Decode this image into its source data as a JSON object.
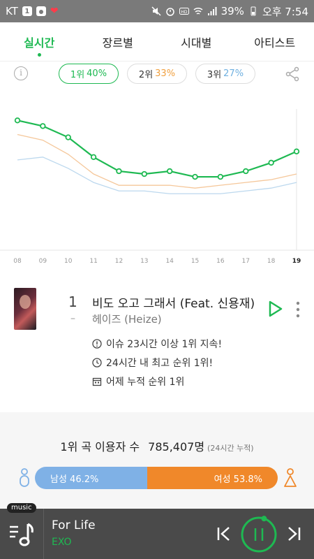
{
  "status_bar": {
    "carrier": "KT",
    "badge": "1",
    "battery": "39%",
    "time": "오후 7:54"
  },
  "tabs": [
    {
      "label": "실시간",
      "active": true
    },
    {
      "label": "장르별",
      "active": false
    },
    {
      "label": "시대별",
      "active": false
    },
    {
      "label": "아티스트",
      "active": false
    }
  ],
  "rank_pills": [
    {
      "rank": "1위",
      "percent": "40%"
    },
    {
      "rank": "2위",
      "percent": "33%"
    },
    {
      "rank": "3위",
      "percent": "27%"
    }
  ],
  "chart_data": {
    "type": "line",
    "x": [
      "08",
      "09",
      "10",
      "11",
      "12",
      "13",
      "14",
      "15",
      "16",
      "17",
      "18",
      "19"
    ],
    "series": [
      {
        "values": [
          46,
          44,
          40,
          33,
          28,
          27,
          28,
          26,
          26,
          28,
          31,
          35
        ],
        "color": "#1eb952"
      },
      {
        "values": [
          41,
          39,
          34,
          27,
          23,
          23,
          23,
          22,
          23,
          24,
          25,
          27
        ],
        "color": "#f5c79a"
      },
      {
        "values": [
          32,
          33,
          29,
          24,
          21,
          21,
          20,
          20,
          20,
          21,
          22,
          24
        ],
        "color": "#bcd8ee"
      }
    ],
    "ylim": [
      0,
      55
    ],
    "grid": false
  },
  "song": {
    "rank": "1",
    "change": "–",
    "title": "비도 오고 그래서 (Feat. 신용재)",
    "artist": "헤이즈 (Heize)",
    "facts": [
      "이슈 23시간 이상 1위 지속!",
      "24시간 내 최고 순위 1위!",
      "어제 누적 순위 1위"
    ]
  },
  "listeners": {
    "title": "1위 곡 이용자 수",
    "count": "785,407명",
    "note": "(24시간 누적)",
    "male_label": "남성 46.2%",
    "female_label": "여성 53.8%",
    "male_share": 0.462,
    "female_share": 0.538
  },
  "player": {
    "badge": "music",
    "track": "For Life",
    "artist": "EXO",
    "progress": 0.05
  }
}
